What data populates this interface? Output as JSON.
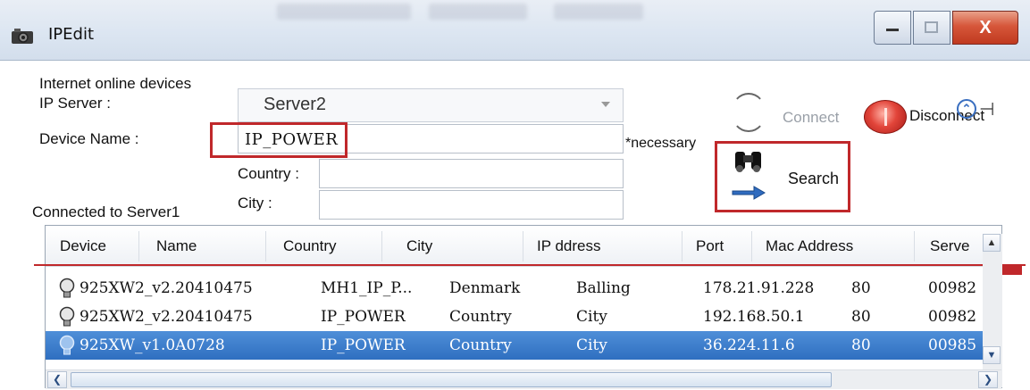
{
  "window": {
    "title": "IPEdit",
    "close_glyph": "X"
  },
  "form": {
    "group_label": "Internet online devices",
    "ip_server_label": "IP Server :",
    "ip_server_value": "Server2",
    "device_name_label": "Device Name :",
    "device_name_value": "IP_POWER",
    "necessary_note": "*necessary",
    "country_label": "Country :",
    "country_value": "",
    "city_label": "City :",
    "city_value": "",
    "status_text": "Connected to Server1"
  },
  "actions": {
    "connect_label": "Connect",
    "disconnect_label": "Disconnect",
    "search_label": "Search"
  },
  "icons": [
    "help-icon",
    "pin-icon",
    "binoculars-icon",
    "disconnect-icon",
    "bulb-icon"
  ],
  "table": {
    "columns": [
      "Device",
      "Name",
      "Country",
      "City",
      "IP ddress",
      "Port",
      "Mac Address",
      "Serve"
    ],
    "rows": [
      {
        "device": "925XW2_v2.20410475",
        "name": "MH1_IP_P...",
        "country": "Denmark",
        "city": "Balling",
        "ip": "178.21.91.228",
        "port": "80",
        "mac": "00982",
        "selected": false
      },
      {
        "device": "925XW2_v2.20410475",
        "name": "IP_POWER",
        "country": "Country",
        "city": "City",
        "ip": "192.168.50.1",
        "port": "80",
        "mac": "00982",
        "selected": false
      },
      {
        "device": "925XW_v1.0A0728",
        "name": "IP_POWER",
        "country": "Country",
        "city": "City",
        "ip": "36.224.11.6",
        "port": "80",
        "mac": "00985",
        "selected": true
      }
    ]
  },
  "colors": {
    "highlight_red": "#c0282b",
    "selection_blue": "#2f6fc0"
  }
}
